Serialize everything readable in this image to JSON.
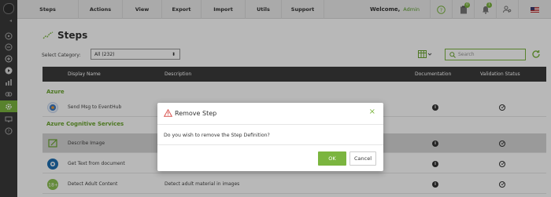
{
  "nav": {
    "items": [
      "Steps",
      "Actions",
      "View",
      "Export",
      "Import",
      "Utils",
      "Support"
    ],
    "welcome_label": "Welcome,",
    "user_name": "Admin",
    "task_badge": "0",
    "notification_badge": "1"
  },
  "page": {
    "title": "Steps",
    "category_label": "Select Category:",
    "category_value": "All (232)",
    "search_placeholder": "Search"
  },
  "table": {
    "columns": [
      "Display Name",
      "Description",
      "Documentation",
      "Validation Status"
    ],
    "groups": [
      {
        "name": "Azure",
        "rows": [
          {
            "display_name": "Send Msg to EventHub",
            "description": ""
          }
        ]
      },
      {
        "name": "Azure Cognitive Services",
        "rows": [
          {
            "display_name": "Describe Image",
            "description": ""
          },
          {
            "display_name": "Get Text from document",
            "description": ""
          },
          {
            "display_name": "Detect Adult Content",
            "description": "Detect adult material in images"
          }
        ]
      }
    ],
    "doc_icon_glyph": "i"
  },
  "modal": {
    "title": "Remove Step",
    "message": "Do you wish to remove the Step Definition?",
    "ok_label": "OK",
    "cancel_label": "Cancel",
    "close_glyph": "×"
  },
  "colors": {
    "accent": "#7bb53f",
    "sidebar": "#3a3a3a",
    "table_header": "#3b3b3b"
  }
}
